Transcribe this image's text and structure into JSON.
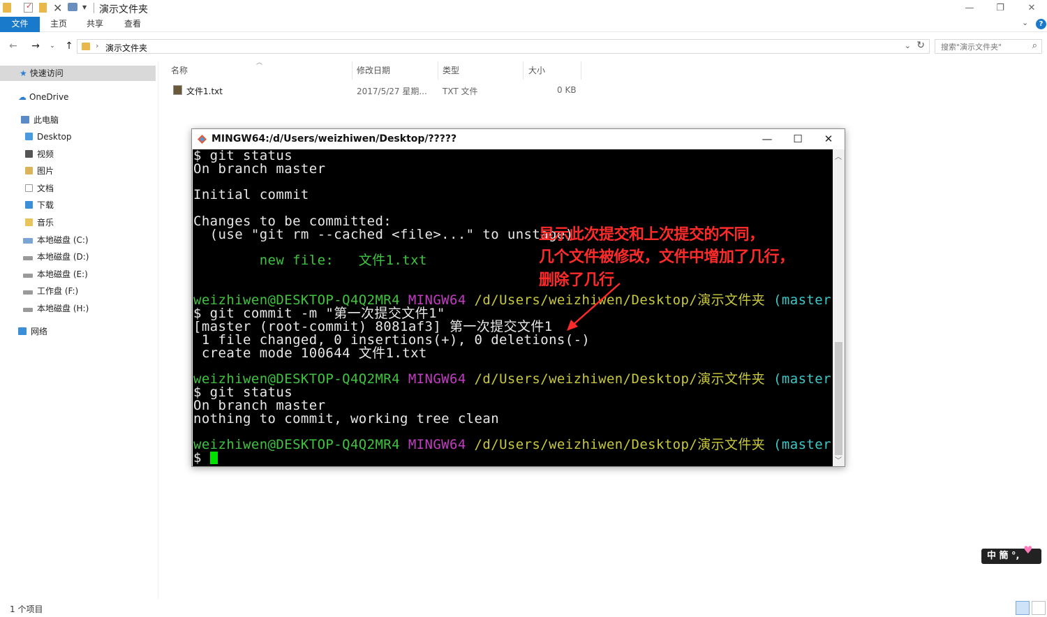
{
  "explorer": {
    "title": "演示文件夹",
    "window_controls": {
      "minimize": "—",
      "maximize": "❐",
      "close": "✕"
    },
    "ribbon_tabs": [
      "文件",
      "主页",
      "共享",
      "查看"
    ],
    "address_path": "演示文件夹",
    "search_placeholder": "搜索\"演示文件夹\"",
    "nav": {
      "quick_access": "快速访问",
      "onedrive": "OneDrive",
      "this_pc": "此电脑",
      "items": [
        "Desktop",
        "视频",
        "图片",
        "文档",
        "下载",
        "音乐",
        "本地磁盘 (C:)",
        "本地磁盘 (D:)",
        "本地磁盘 (E:)",
        "工作盘 (F:)",
        "本地磁盘 (H:)"
      ],
      "network": "网络"
    },
    "columns": {
      "name": "名称",
      "date": "修改日期",
      "type": "类型",
      "size": "大小"
    },
    "files": [
      {
        "name": "文件1.txt",
        "date": "2017/5/27 星期...",
        "type": "TXT 文件",
        "size": "0 KB"
      }
    ],
    "status": "1 个项目"
  },
  "terminal": {
    "title": "MINGW64:/d/Users/weizhiwen/Desktop/?????",
    "controls": {
      "minimize": "—",
      "maximize": "☐",
      "close": "✕"
    },
    "prompt": {
      "user": "weizhiwen@DESKTOP-Q4Q2MR4",
      "shell": "MINGW64",
      "path": "/d/Users/weizhiwen/Desktop/演示文件夹",
      "branch": "(master)"
    },
    "lines": {
      "l1": "$ git status",
      "l2": "On branch master",
      "l3": "Initial commit",
      "l4": "Changes to be committed:",
      "l5": "  (use \"git rm --cached <file>...\" to unstage)",
      "l6_label": "        new file:",
      "l6_file": "   文件1.txt",
      "l7": "$ git commit -m \"第一次提交文件1\"",
      "l8": "[master (root-commit) 8081af3] 第一次提交文件1",
      "l9": " 1 file changed, 0 insertions(+), 0 deletions(-)",
      "l10": " create mode 100644 文件1.txt",
      "l11": "$ git status",
      "l12": "On branch master",
      "l13": "nothing to commit, working tree clean",
      "l14": "$ "
    }
  },
  "annotation": {
    "line1": "显示此次提交和上次提交的不同，",
    "line2": "几个文件被修改，文件中增加了几行，",
    "line3": "删除了几行",
    "color": "#ff2a2a"
  },
  "ime": {
    "label": "中 簡 °,"
  },
  "icons": {
    "quick_access": "star-icon",
    "onedrive": "cloud-icon",
    "this_pc": "computer-icon",
    "network": "network-icon",
    "search": "search-icon"
  }
}
